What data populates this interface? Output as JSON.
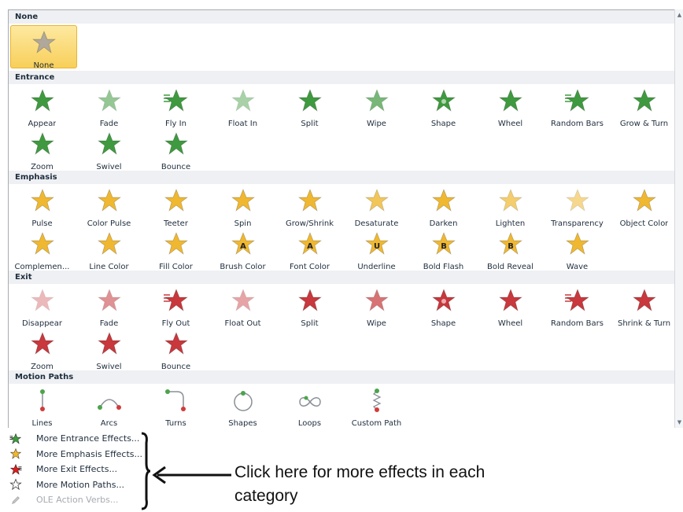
{
  "sections": [
    {
      "title": "None",
      "rows": [
        [
          {
            "label": "None",
            "icon": "star-gray-icon",
            "selected": true
          }
        ]
      ]
    },
    {
      "title": "Entrance",
      "rows": [
        [
          {
            "label": "Appear"
          },
          {
            "label": "Fade"
          },
          {
            "label": "Fly In"
          },
          {
            "label": "Float In"
          },
          {
            "label": "Split"
          },
          {
            "label": "Wipe"
          },
          {
            "label": "Shape"
          },
          {
            "label": "Wheel"
          },
          {
            "label": "Random Bars"
          },
          {
            "label": "Grow & Turn"
          }
        ],
        [
          {
            "label": "Zoom"
          },
          {
            "label": "Swivel"
          },
          {
            "label": "Bounce"
          }
        ]
      ]
    },
    {
      "title": "Emphasis",
      "rows": [
        [
          {
            "label": "Pulse"
          },
          {
            "label": "Color Pulse"
          },
          {
            "label": "Teeter"
          },
          {
            "label": "Spin"
          },
          {
            "label": "Grow/Shrink"
          },
          {
            "label": "Desaturate"
          },
          {
            "label": "Darken"
          },
          {
            "label": "Lighten"
          },
          {
            "label": "Transparency"
          },
          {
            "label": "Object Color"
          }
        ],
        [
          {
            "label": "Complemen..."
          },
          {
            "label": "Line Color"
          },
          {
            "label": "Fill Color"
          },
          {
            "label": "Brush Color"
          },
          {
            "label": "Font Color"
          },
          {
            "label": "Underline"
          },
          {
            "label": "Bold Flash"
          },
          {
            "label": "Bold Reveal"
          },
          {
            "label": "Wave"
          }
        ]
      ]
    },
    {
      "title": "Exit",
      "rows": [
        [
          {
            "label": "Disappear"
          },
          {
            "label": "Fade"
          },
          {
            "label": "Fly Out"
          },
          {
            "label": "Float Out"
          },
          {
            "label": "Split"
          },
          {
            "label": "Wipe"
          },
          {
            "label": "Shape"
          },
          {
            "label": "Wheel"
          },
          {
            "label": "Random Bars"
          },
          {
            "label": "Shrink & Turn"
          }
        ],
        [
          {
            "label": "Zoom"
          },
          {
            "label": "Swivel"
          },
          {
            "label": "Bounce"
          }
        ]
      ]
    },
    {
      "title": "Motion Paths",
      "rows": [
        [
          {
            "label": "Lines"
          },
          {
            "label": "Arcs"
          },
          {
            "label": "Turns"
          },
          {
            "label": "Shapes"
          },
          {
            "label": "Loops"
          },
          {
            "label": "Custom Path"
          }
        ]
      ]
    }
  ],
  "colors": {
    "none": "#b0a89a",
    "entrance": "#3f9a3f",
    "emphasis": "#f0b830",
    "exit": "#c8383c",
    "path_green": "#4ca44c",
    "path_red": "#d23b3b",
    "path_line": "#8a8f96"
  },
  "menu": {
    "items": [
      {
        "label": "More Entrance Effects...",
        "icon": "entrance-star-icon"
      },
      {
        "label": "More Emphasis Effects...",
        "icon": "emphasis-star-icon"
      },
      {
        "label": "More Exit Effects...",
        "icon": "exit-star-icon"
      },
      {
        "label": "More Motion Paths...",
        "icon": "outline-star-icon"
      },
      {
        "label": "OLE Action Verbs...",
        "icon": "pencil-icon",
        "disabled": true
      }
    ]
  },
  "callout": {
    "text": "Click here for more effects in each category"
  }
}
